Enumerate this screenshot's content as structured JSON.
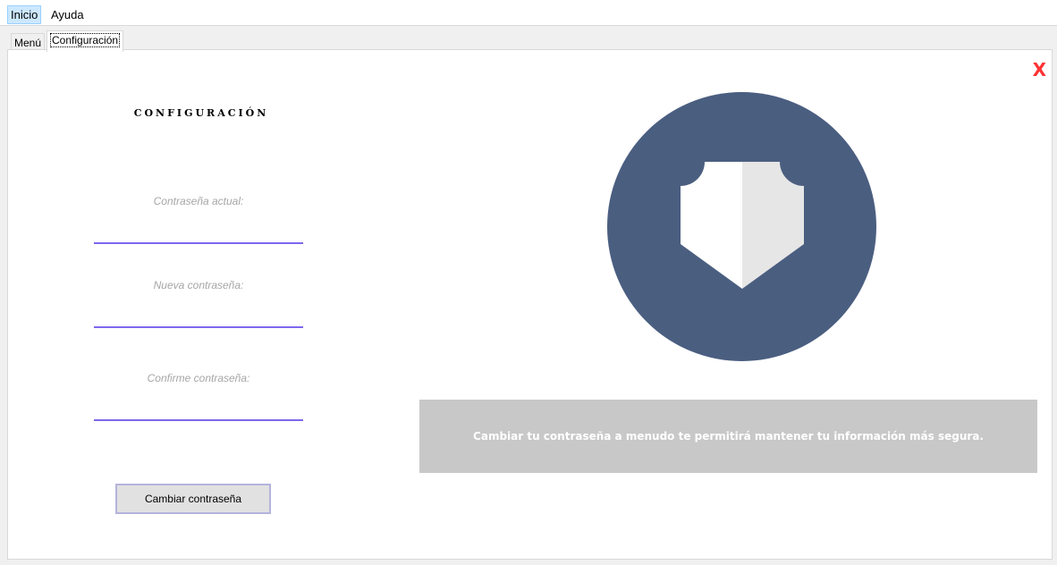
{
  "menubar": {
    "items": [
      {
        "label": "Inicio"
      },
      {
        "label": "Ayuda"
      }
    ]
  },
  "tabs": [
    {
      "label": "Menú"
    },
    {
      "label": "Configuración"
    }
  ],
  "panel": {
    "close_label": "X",
    "title": "CONFIGURACIÓN",
    "fields": [
      {
        "label": "Contraseña actual:",
        "value": ""
      },
      {
        "label": "Nueva contraseña:",
        "value": ""
      },
      {
        "label": "Confirme contraseña:",
        "value": ""
      }
    ],
    "button_label": "Cambiar contraseña",
    "info_text": "Cambiar tu contraseña a menudo te permitirá mantener tu información más segura."
  },
  "colors": {
    "accent_underline": "#7b68ee",
    "circle": "#4a5e80",
    "close": "#ff3333",
    "banner": "#c8c8c8"
  },
  "icons": {
    "hero": "shield-icon"
  }
}
